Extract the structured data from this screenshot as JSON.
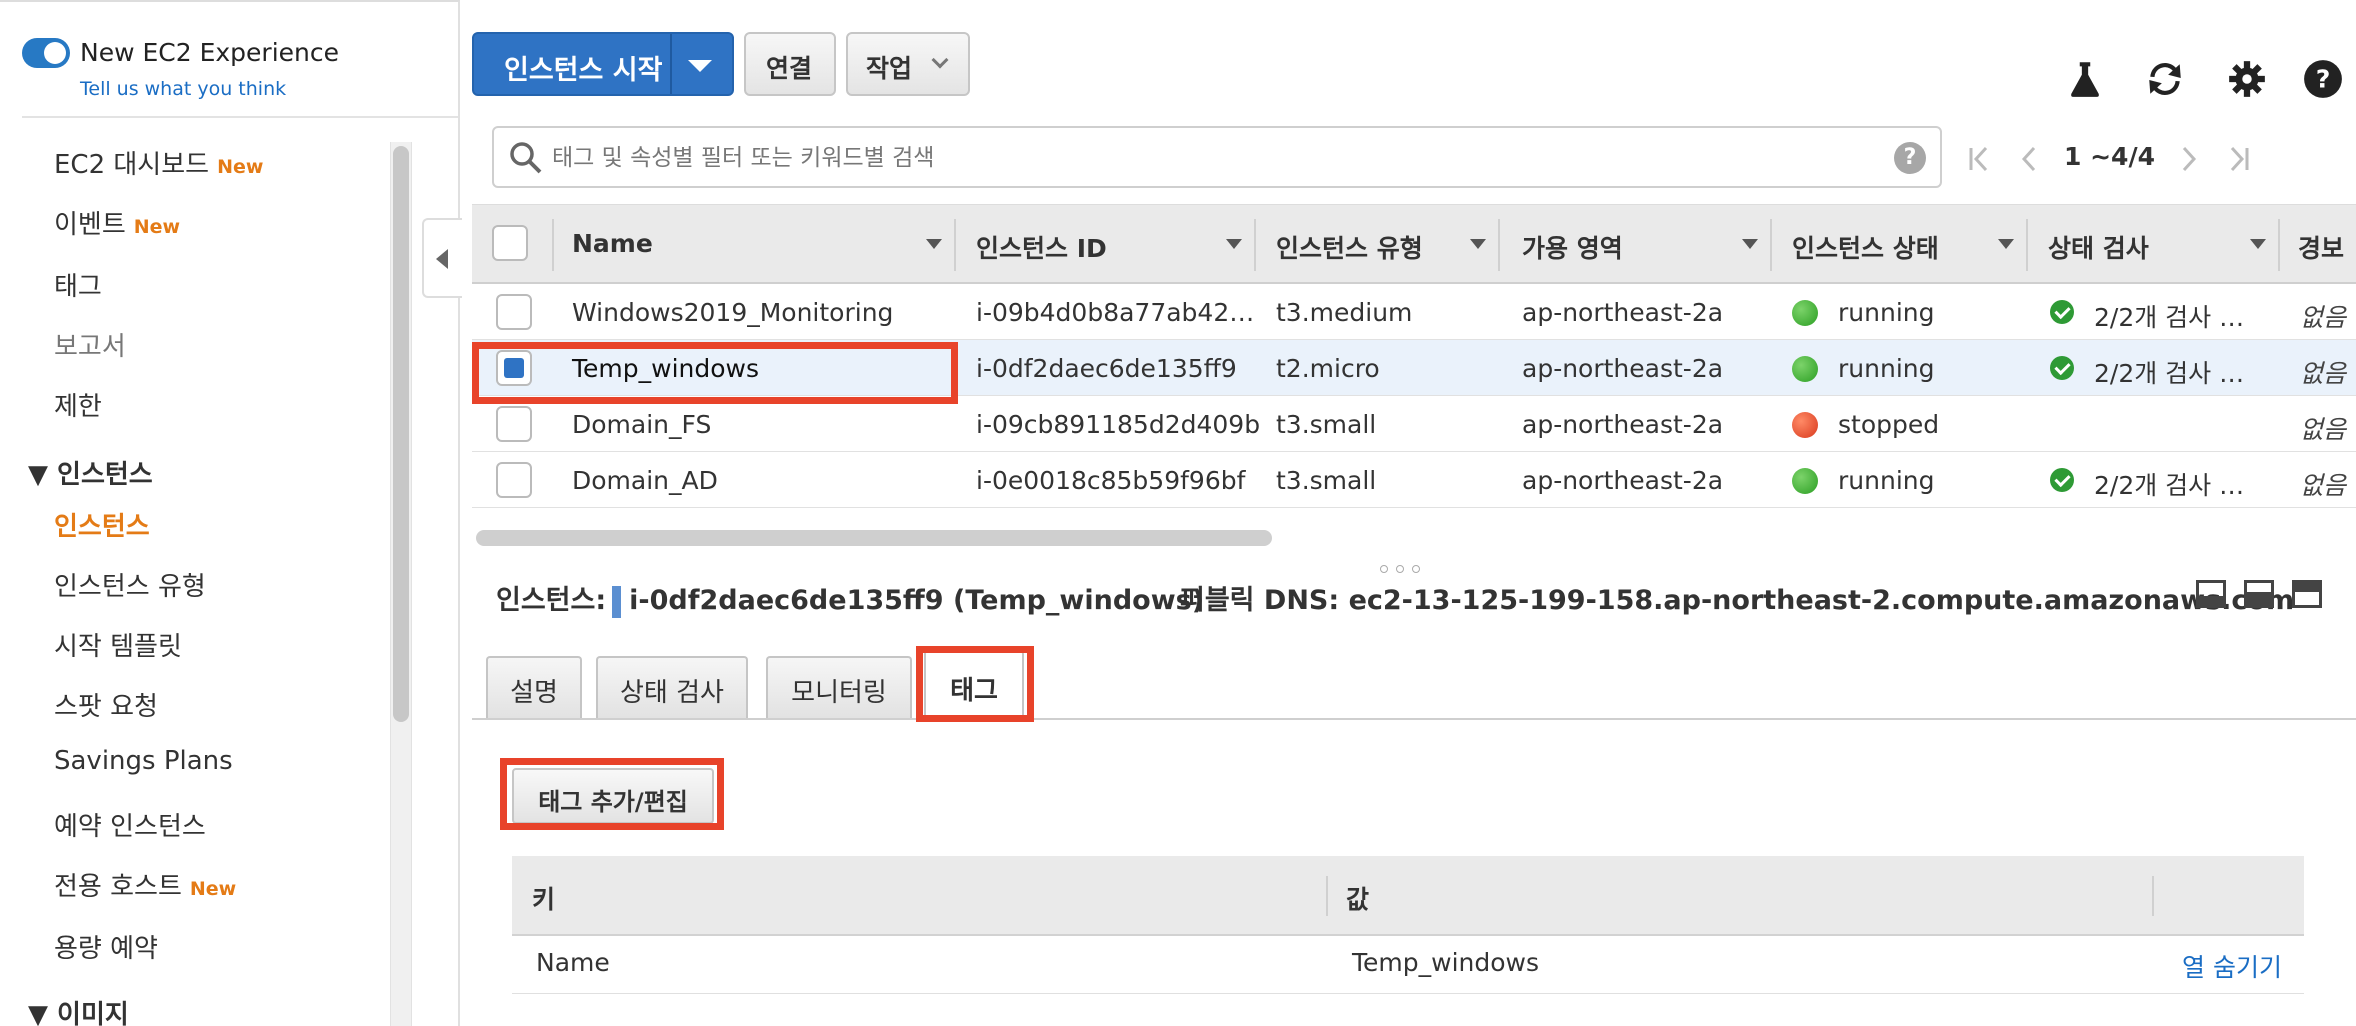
{
  "sidebar": {
    "experience_title": "New EC2 Experience",
    "experience_link": "Tell us what you think",
    "items": [
      {
        "label": "EC2 대시보드",
        "badge": "New"
      },
      {
        "label": "이벤트",
        "badge": "New"
      },
      {
        "label": "태그"
      },
      {
        "label": "보고서"
      },
      {
        "label": "제한"
      }
    ],
    "section_instances": "인스턴스",
    "instance_items": [
      {
        "label": "인스턴스"
      },
      {
        "label": "인스턴스 유형"
      },
      {
        "label": "시작 템플릿"
      },
      {
        "label": "스팟 요청"
      },
      {
        "label": "Savings Plans"
      },
      {
        "label": "예약 인스턴스"
      },
      {
        "label": "전용 호스트",
        "badge": "New"
      },
      {
        "label": "용량 예약"
      }
    ],
    "section_images": "이미지"
  },
  "toolbar": {
    "launch_label": "인스턴스 시작",
    "connect_label": "연결",
    "actions_label": "작업"
  },
  "search": {
    "placeholder": "태그 및 속성별 필터 또는 키워드별 검색",
    "help": "?"
  },
  "pager": {
    "range": "1 ~4/4"
  },
  "table": {
    "columns": [
      "Name",
      "인스턴스 ID",
      "인스턴스 유형",
      "가용 영역",
      "인스턴스 상태",
      "상태 검사",
      "경보"
    ],
    "rows": [
      {
        "name": "Windows2019_Monitoring",
        "id": "i-09b4d0b8a77ab42…",
        "type": "t3.medium",
        "az": "ap-northeast-2a",
        "state": "running",
        "check": "2/2개 검사 …",
        "alarm": "없음"
      },
      {
        "name": "Temp_windows",
        "id": "i-0df2daec6de135ff9",
        "type": "t2.micro",
        "az": "ap-northeast-2a",
        "state": "running",
        "check": "2/2개 검사 …",
        "alarm": "없음"
      },
      {
        "name": "Domain_FS",
        "id": "i-09cb891185d2d409b",
        "type": "t3.small",
        "az": "ap-northeast-2a",
        "state": "stopped",
        "check": "",
        "alarm": "없음"
      },
      {
        "name": "Domain_AD",
        "id": "i-0e0018c85b59f96bf",
        "type": "t3.small",
        "az": "ap-northeast-2a",
        "state": "running",
        "check": "2/2개 검사 …",
        "alarm": "없음"
      }
    ]
  },
  "details": {
    "instance_label": "인스턴스:",
    "instance_value": "i-0df2daec6de135ff9 (Temp_windows)",
    "dns_label": "퍼블릭 DNS:",
    "dns_value": "ec2-13-125-199-158.ap-northeast-2.compute.amazonaws.com",
    "tabs": [
      "설명",
      "상태 검사",
      "모니터링",
      "태그"
    ],
    "add_tag_label": "태그 추가/편집",
    "tag_columns": [
      "키",
      "값"
    ],
    "tag_rows": [
      {
        "key": "Name",
        "value": "Temp_windows"
      }
    ],
    "hide_column_label": "열 숨기기"
  },
  "colors": {
    "accent": "#2f73c4",
    "active_nav": "#e47b16",
    "highlight": "#e8432a",
    "running": "#2b9e23",
    "stopped": "#d8391d"
  },
  "icons": [
    "flask-icon",
    "refresh-icon",
    "gear-icon",
    "help-icon",
    "search-icon"
  ]
}
